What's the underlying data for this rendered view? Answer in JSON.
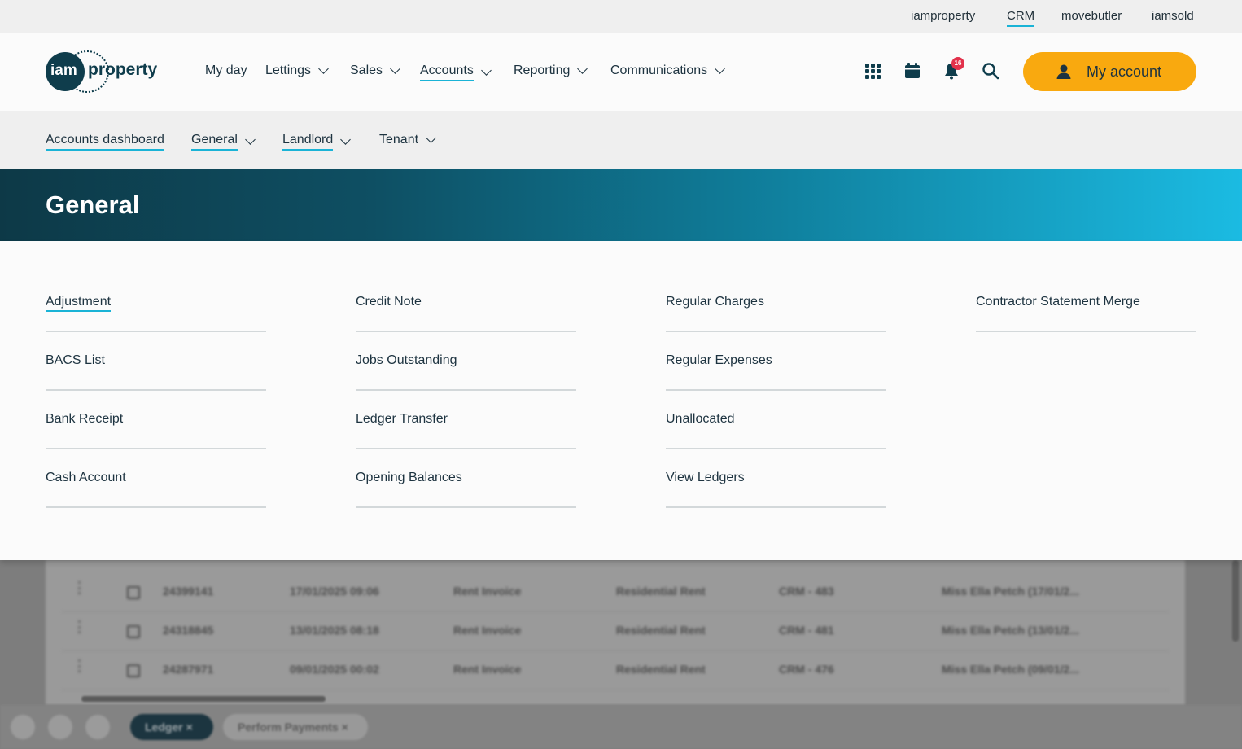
{
  "top_links": [
    "iamproperty",
    "CRM",
    "movebutler",
    "iamsold"
  ],
  "logo": {
    "mark": "iam",
    "word": "property"
  },
  "main_nav": [
    {
      "label": "My day",
      "dropdown": false
    },
    {
      "label": "Lettings",
      "dropdown": true
    },
    {
      "label": "Sales",
      "dropdown": true
    },
    {
      "label": "Accounts",
      "dropdown": true,
      "active": true
    },
    {
      "label": "Reporting",
      "dropdown": true
    },
    {
      "label": "Communications",
      "dropdown": true
    }
  ],
  "header_icons": [
    "apps-grid-icon",
    "calendar-icon",
    "bell-icon",
    "search-icon"
  ],
  "notifications": {
    "count": "16"
  },
  "account_button": {
    "label": "My account",
    "icon": "user-icon",
    "color": "#f9a90f"
  },
  "sub_nav": [
    {
      "label": "Accounts dashboard",
      "dropdown": false
    },
    {
      "label": "General",
      "dropdown": true
    },
    {
      "label": "Landlord",
      "dropdown": true
    },
    {
      "label": "Tenant",
      "dropdown": true
    }
  ],
  "banner": {
    "title": "General"
  },
  "menu_columns": [
    [
      "Adjustment",
      "BACS List",
      "Bank Receipt",
      "Cash Account"
    ],
    [
      "Credit Note",
      "Jobs Outstanding",
      "Ledger Transfer",
      "Opening Balances"
    ],
    [
      "Regular Charges",
      "Regular Expenses",
      "Unallocated",
      "View Ledgers"
    ],
    [
      "Contractor Statement Merge"
    ]
  ],
  "background_table": {
    "rows": [
      [
        "24399141",
        "17/01/2025 09:06",
        "Rent Invoice",
        "Residential Rent",
        "CRM - 483",
        "Miss Ella Petch (17/01/2..."
      ],
      [
        "24318845",
        "13/01/2025 08:18",
        "Rent Invoice",
        "Residential Rent",
        "CRM - 481",
        "Miss Ella Petch (13/01/2..."
      ],
      [
        "24287971",
        "09/01/2025 00:02",
        "Rent Invoice",
        "Residential Rent",
        "CRM - 476",
        "Miss Ella Petch (09/01/2..."
      ]
    ]
  },
  "bottom_tabs": [
    "Ledger",
    "Perform Payments"
  ],
  "colors": {
    "accent": "#1ab3d6",
    "brand_dark": "#0f3d4c",
    "badge": "#e2314b"
  }
}
